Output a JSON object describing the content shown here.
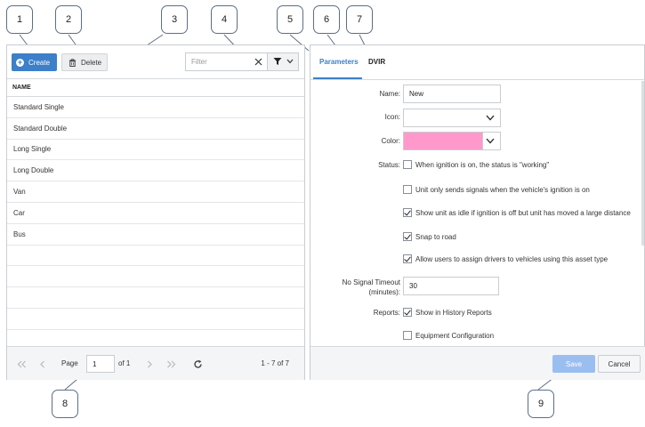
{
  "callouts": [
    "1",
    "2",
    "3",
    "4",
    "5",
    "6",
    "7",
    "8",
    "9"
  ],
  "toolbar": {
    "create_label": "Create",
    "delete_label": "Delete",
    "filter_placeholder": "Filter"
  },
  "table": {
    "header": "NAME",
    "rows": [
      "Standard Single",
      "Standard Double",
      "Long Single",
      "Long Double",
      "Van",
      "Car",
      "Bus"
    ]
  },
  "pager": {
    "page_label": "Page",
    "page_value": "1",
    "of_label": "of 1",
    "range": "1 - 7 of 7"
  },
  "tabs": {
    "parameters": "Parameters",
    "dvir": "DVIR"
  },
  "form": {
    "name_label": "Name:",
    "name_value": "New",
    "icon_label": "Icon:",
    "color_label": "Color:",
    "color_value": "#ff99cc",
    "status_label": "Status:",
    "status_options": [
      {
        "label": "When ignition is on, the status is \"working\"",
        "checked": false
      },
      {
        "label": "Unit only sends signals when the vehicle's ignition is on",
        "checked": false
      },
      {
        "label": "Show unit as idle if ignition is off but unit has moved a large distance",
        "checked": true
      },
      {
        "label": "Snap to road",
        "checked": true
      },
      {
        "label": "Allow users to assign drivers to vehicles using this asset type",
        "checked": true
      }
    ],
    "timeout_label_1": "No Signal Timeout",
    "timeout_label_2": "(minutes):",
    "timeout_value": "30",
    "reports_label": "Reports:",
    "reports_options": [
      {
        "label": "Show in History Reports",
        "checked": true
      },
      {
        "label": "Equipment Configuration",
        "checked": false
      }
    ]
  },
  "footer": {
    "save_label": "Save",
    "cancel_label": "Cancel"
  },
  "colors": {
    "accent": "#3d7fc9",
    "save_disabled": "#9bbef0",
    "swatch": "#ff99cc"
  },
  "icons": {
    "create": "circle-plus-icon",
    "delete": "trash-icon",
    "filter_clear": "close-icon",
    "filter_menu": "funnel-icon",
    "pager": [
      "first-page-icon",
      "prev-page-icon",
      "next-page-icon",
      "last-page-icon",
      "refresh-icon"
    ]
  }
}
